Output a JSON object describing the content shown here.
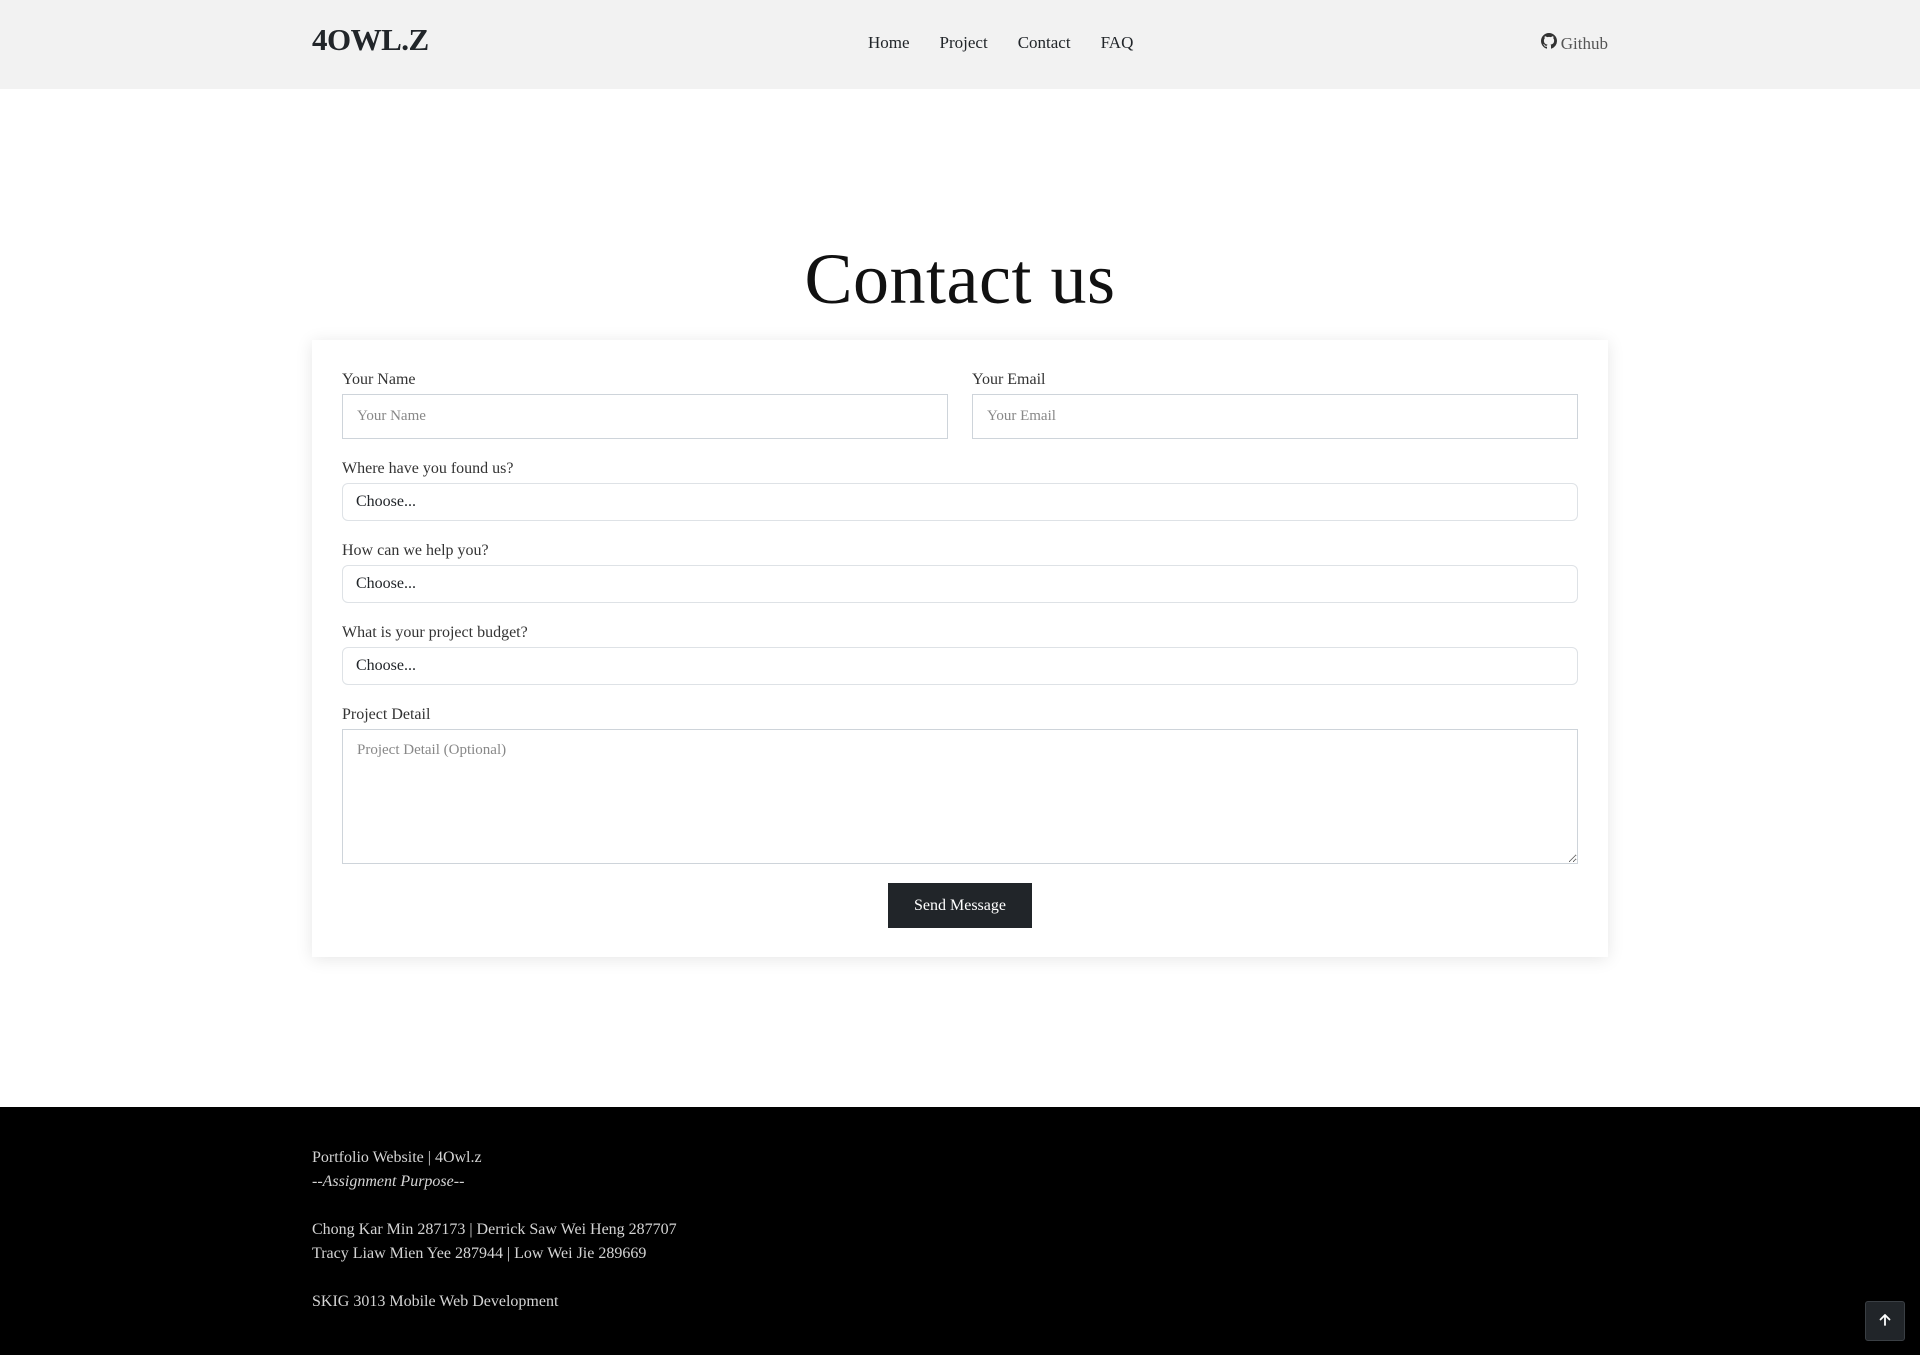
{
  "navbar": {
    "brand": "4OWL.Z",
    "links": [
      "Home",
      "Project",
      "Contact",
      "FAQ"
    ],
    "github_label": "Github"
  },
  "main": {
    "title": "Contact us"
  },
  "form": {
    "name_label": "Your Name",
    "name_placeholder": "Your Name",
    "email_label": "Your Email",
    "email_placeholder": "Your Email",
    "source_label": "Where have you found us?",
    "source_value": "Choose...",
    "help_label": "How can we help you?",
    "help_value": "Choose...",
    "budget_label": "What is your project budget?",
    "budget_value": "Choose...",
    "detail_label": "Project Detail",
    "detail_placeholder": "Project Detail (Optional)",
    "submit_label": "Send Message"
  },
  "footer": {
    "line1": "Portfolio Website | 4Owl.z",
    "line2": "--Assignment Purpose--",
    "line3": "Chong Kar Min 287173 | Derrick Saw Wei Heng 287707",
    "line4": "Tracy Liaw Mien Yee 287944 | Low Wei Jie 289669",
    "line5": "SKIG 3013 Mobile Web Development"
  },
  "icons": {
    "github": "github-icon",
    "back_to_top": "arrow-up-icon"
  }
}
